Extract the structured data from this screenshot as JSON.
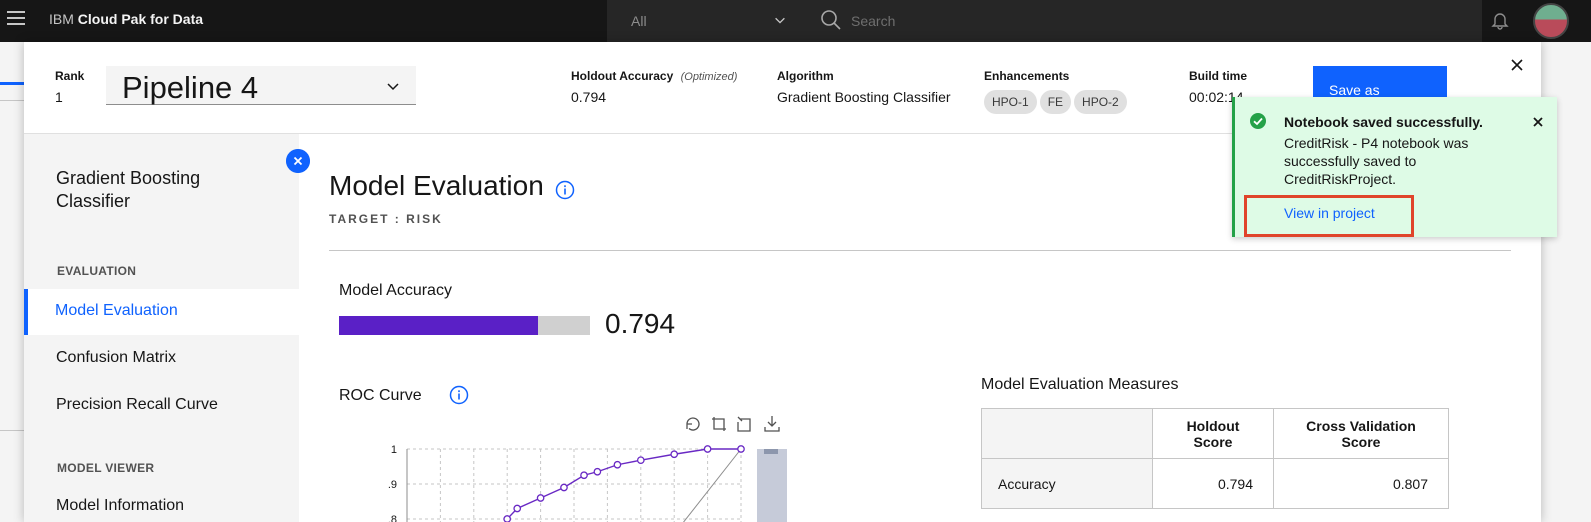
{
  "shell": {
    "brand_prefix": "IBM",
    "brand_name": "Cloud Pak for Data",
    "scope_value": "All",
    "search_placeholder": "Search"
  },
  "header": {
    "rank_label": "Rank",
    "rank_value": "1",
    "pipeline_name": "Pipeline 4",
    "holdout_label": "Holdout Accuracy",
    "holdout_note": "(Optimized)",
    "holdout_value": "0.794",
    "algorithm_label": "Algorithm",
    "algorithm_value": "Gradient Boosting Classifier",
    "enhancements_label": "Enhancements",
    "enhancements": [
      "HPO-1",
      "FE",
      "HPO-2"
    ],
    "build_time_label": "Build time",
    "build_time_value": "00:02:14",
    "save_as_label": "Save as"
  },
  "sidebar": {
    "model_name": "Gradient Boosting Classifier",
    "evaluation_section": "EVALUATION",
    "evaluation_items": [
      "Model Evaluation",
      "Confusion Matrix",
      "Precision Recall Curve"
    ],
    "active_item": "Model Evaluation",
    "viewer_section": "MODEL VIEWER",
    "viewer_items": [
      "Model Information"
    ]
  },
  "main": {
    "title": "Model Evaluation",
    "target": "TARGET : RISK",
    "accuracy_label": "Model Accuracy",
    "accuracy_value": "0.794",
    "accuracy_fraction": 0.794,
    "roc_label": "ROC Curve",
    "measures_label": "Model Evaluation Measures",
    "measures_columns": [
      "",
      "Holdout Score",
      "Cross Validation Score"
    ],
    "measures_rows": [
      {
        "metric": "Accuracy",
        "holdout": "0.794",
        "cv": "0.807"
      }
    ]
  },
  "chart_data": {
    "type": "line",
    "title": "ROC Curve",
    "y_ticks": [
      "1",
      ".9",
      ".8"
    ],
    "ylim": [
      0.8,
      1.0
    ],
    "series": [
      {
        "x": [
          0.3,
          0.33,
          0.4,
          0.47,
          0.53,
          0.57,
          0.63,
          0.7,
          0.8,
          0.9,
          1.0
        ],
        "values": [
          0.8,
          0.83,
          0.86,
          0.89,
          0.925,
          0.935,
          0.955,
          0.968,
          0.985,
          1.0,
          1.0
        ],
        "color": "#6929c4"
      }
    ]
  },
  "toast": {
    "title": "Notebook saved successfully.",
    "message": "CreditRisk - P4 notebook was successfully saved to CreditRiskProject.",
    "link": "View in project"
  }
}
